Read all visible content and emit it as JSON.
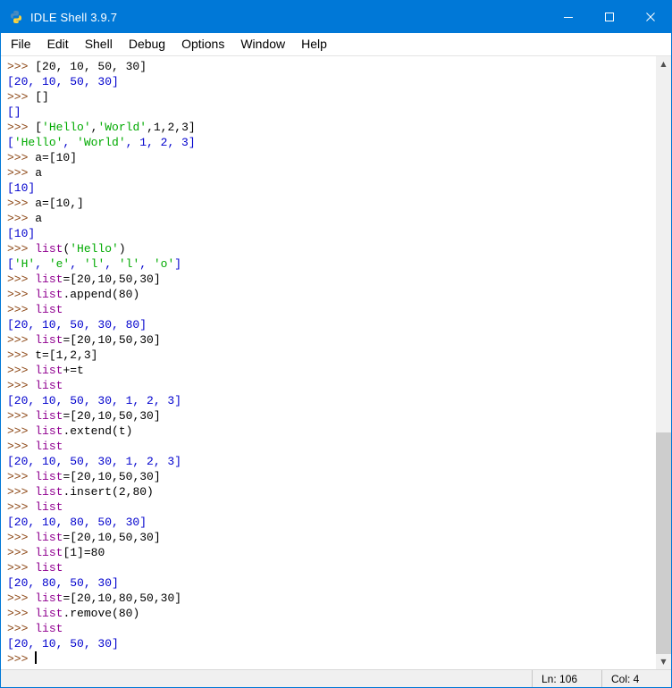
{
  "window": {
    "title": "IDLE Shell 3.9.7"
  },
  "menu": {
    "items": [
      "File",
      "Edit",
      "Shell",
      "Debug",
      "Options",
      "Window",
      "Help"
    ]
  },
  "colors": {
    "titlebar": "#0078d7",
    "titlebar_text": "#ffffff",
    "p": "#8b4513",
    "c": "#000000",
    "o": "#0000cd",
    "s": "#00aa00",
    "b": "#900090"
  },
  "scrollbar": {
    "up_arrow": "▲",
    "down_arrow": "▼"
  },
  "shell": {
    "cursor_line": 39,
    "lines": [
      [
        [
          "p",
          ">>> "
        ],
        [
          "c",
          "[20, 10, 50, 30]"
        ]
      ],
      [
        [
          "o",
          "[20, 10, 50, 30]"
        ]
      ],
      [
        [
          "p",
          ">>> "
        ],
        [
          "c",
          "[]"
        ]
      ],
      [
        [
          "o",
          "[]"
        ]
      ],
      [
        [
          "p",
          ">>> "
        ],
        [
          "c",
          "["
        ],
        [
          "s",
          "'Hello'"
        ],
        [
          "c",
          ","
        ],
        [
          "s",
          "'World'"
        ],
        [
          "c",
          ",1,2,3]"
        ]
      ],
      [
        [
          "o",
          "["
        ],
        [
          "s",
          "'Hello'"
        ],
        [
          "o",
          ", "
        ],
        [
          "s",
          "'World'"
        ],
        [
          "o",
          ", 1, 2, 3]"
        ]
      ],
      [
        [
          "p",
          ">>> "
        ],
        [
          "c",
          "a=[10]"
        ]
      ],
      [
        [
          "p",
          ">>> "
        ],
        [
          "c",
          "a"
        ]
      ],
      [
        [
          "o",
          "[10]"
        ]
      ],
      [
        [
          "p",
          ">>> "
        ],
        [
          "c",
          "a=[10,]"
        ]
      ],
      [
        [
          "p",
          ">>> "
        ],
        [
          "c",
          "a"
        ]
      ],
      [
        [
          "o",
          "[10]"
        ]
      ],
      [
        [
          "p",
          ">>> "
        ],
        [
          "b",
          "list"
        ],
        [
          "c",
          "("
        ],
        [
          "s",
          "'Hello'"
        ],
        [
          "c",
          ")"
        ]
      ],
      [
        [
          "o",
          "["
        ],
        [
          "s",
          "'H'"
        ],
        [
          "o",
          ", "
        ],
        [
          "s",
          "'e'"
        ],
        [
          "o",
          ", "
        ],
        [
          "s",
          "'l'"
        ],
        [
          "o",
          ", "
        ],
        [
          "s",
          "'l'"
        ],
        [
          "o",
          ", "
        ],
        [
          "s",
          "'o'"
        ],
        [
          "o",
          "]"
        ]
      ],
      [
        [
          "p",
          ">>> "
        ],
        [
          "b",
          "list"
        ],
        [
          "c",
          "=[20,10,50,30]"
        ]
      ],
      [
        [
          "p",
          ">>> "
        ],
        [
          "b",
          "list"
        ],
        [
          "c",
          ".append(80)"
        ]
      ],
      [
        [
          "p",
          ">>> "
        ],
        [
          "b",
          "list"
        ]
      ],
      [
        [
          "o",
          "[20, 10, 50, 30, 80]"
        ]
      ],
      [
        [
          "p",
          ">>> "
        ],
        [
          "b",
          "list"
        ],
        [
          "c",
          "=[20,10,50,30]"
        ]
      ],
      [
        [
          "p",
          ">>> "
        ],
        [
          "c",
          "t=[1,2,3]"
        ]
      ],
      [
        [
          "p",
          ">>> "
        ],
        [
          "b",
          "list"
        ],
        [
          "c",
          "+=t"
        ]
      ],
      [
        [
          "p",
          ">>> "
        ],
        [
          "b",
          "list"
        ]
      ],
      [
        [
          "o",
          "[20, 10, 50, 30, 1, 2, 3]"
        ]
      ],
      [
        [
          "p",
          ">>> "
        ],
        [
          "b",
          "list"
        ],
        [
          "c",
          "=[20,10,50,30]"
        ]
      ],
      [
        [
          "p",
          ">>> "
        ],
        [
          "b",
          "list"
        ],
        [
          "c",
          ".extend(t)"
        ]
      ],
      [
        [
          "p",
          ">>> "
        ],
        [
          "b",
          "list"
        ]
      ],
      [
        [
          "o",
          "[20, 10, 50, 30, 1, 2, 3]"
        ]
      ],
      [
        [
          "p",
          ">>> "
        ],
        [
          "b",
          "list"
        ],
        [
          "c",
          "=[20,10,50,30]"
        ]
      ],
      [
        [
          "p",
          ">>> "
        ],
        [
          "b",
          "list"
        ],
        [
          "c",
          ".insert(2,80)"
        ]
      ],
      [
        [
          "p",
          ">>> "
        ],
        [
          "b",
          "list"
        ]
      ],
      [
        [
          "o",
          "[20, 10, 80, 50, 30]"
        ]
      ],
      [
        [
          "p",
          ">>> "
        ],
        [
          "b",
          "list"
        ],
        [
          "c",
          "=[20,10,50,30]"
        ]
      ],
      [
        [
          "p",
          ">>> "
        ],
        [
          "b",
          "list"
        ],
        [
          "c",
          "[1]=80"
        ]
      ],
      [
        [
          "p",
          ">>> "
        ],
        [
          "b",
          "list"
        ]
      ],
      [
        [
          "o",
          "[20, 80, 50, 30]"
        ]
      ],
      [
        [
          "p",
          ">>> "
        ],
        [
          "b",
          "list"
        ],
        [
          "c",
          "=[20,10,80,50,30]"
        ]
      ],
      [
        [
          "p",
          ">>> "
        ],
        [
          "b",
          "list"
        ],
        [
          "c",
          ".remove(80)"
        ]
      ],
      [
        [
          "p",
          ">>> "
        ],
        [
          "b",
          "list"
        ]
      ],
      [
        [
          "o",
          "[20, 10, 50, 30]"
        ]
      ],
      [
        [
          "p",
          ">>> "
        ]
      ]
    ]
  },
  "statusbar": {
    "line": "Ln: 106",
    "col": "Col: 4"
  }
}
